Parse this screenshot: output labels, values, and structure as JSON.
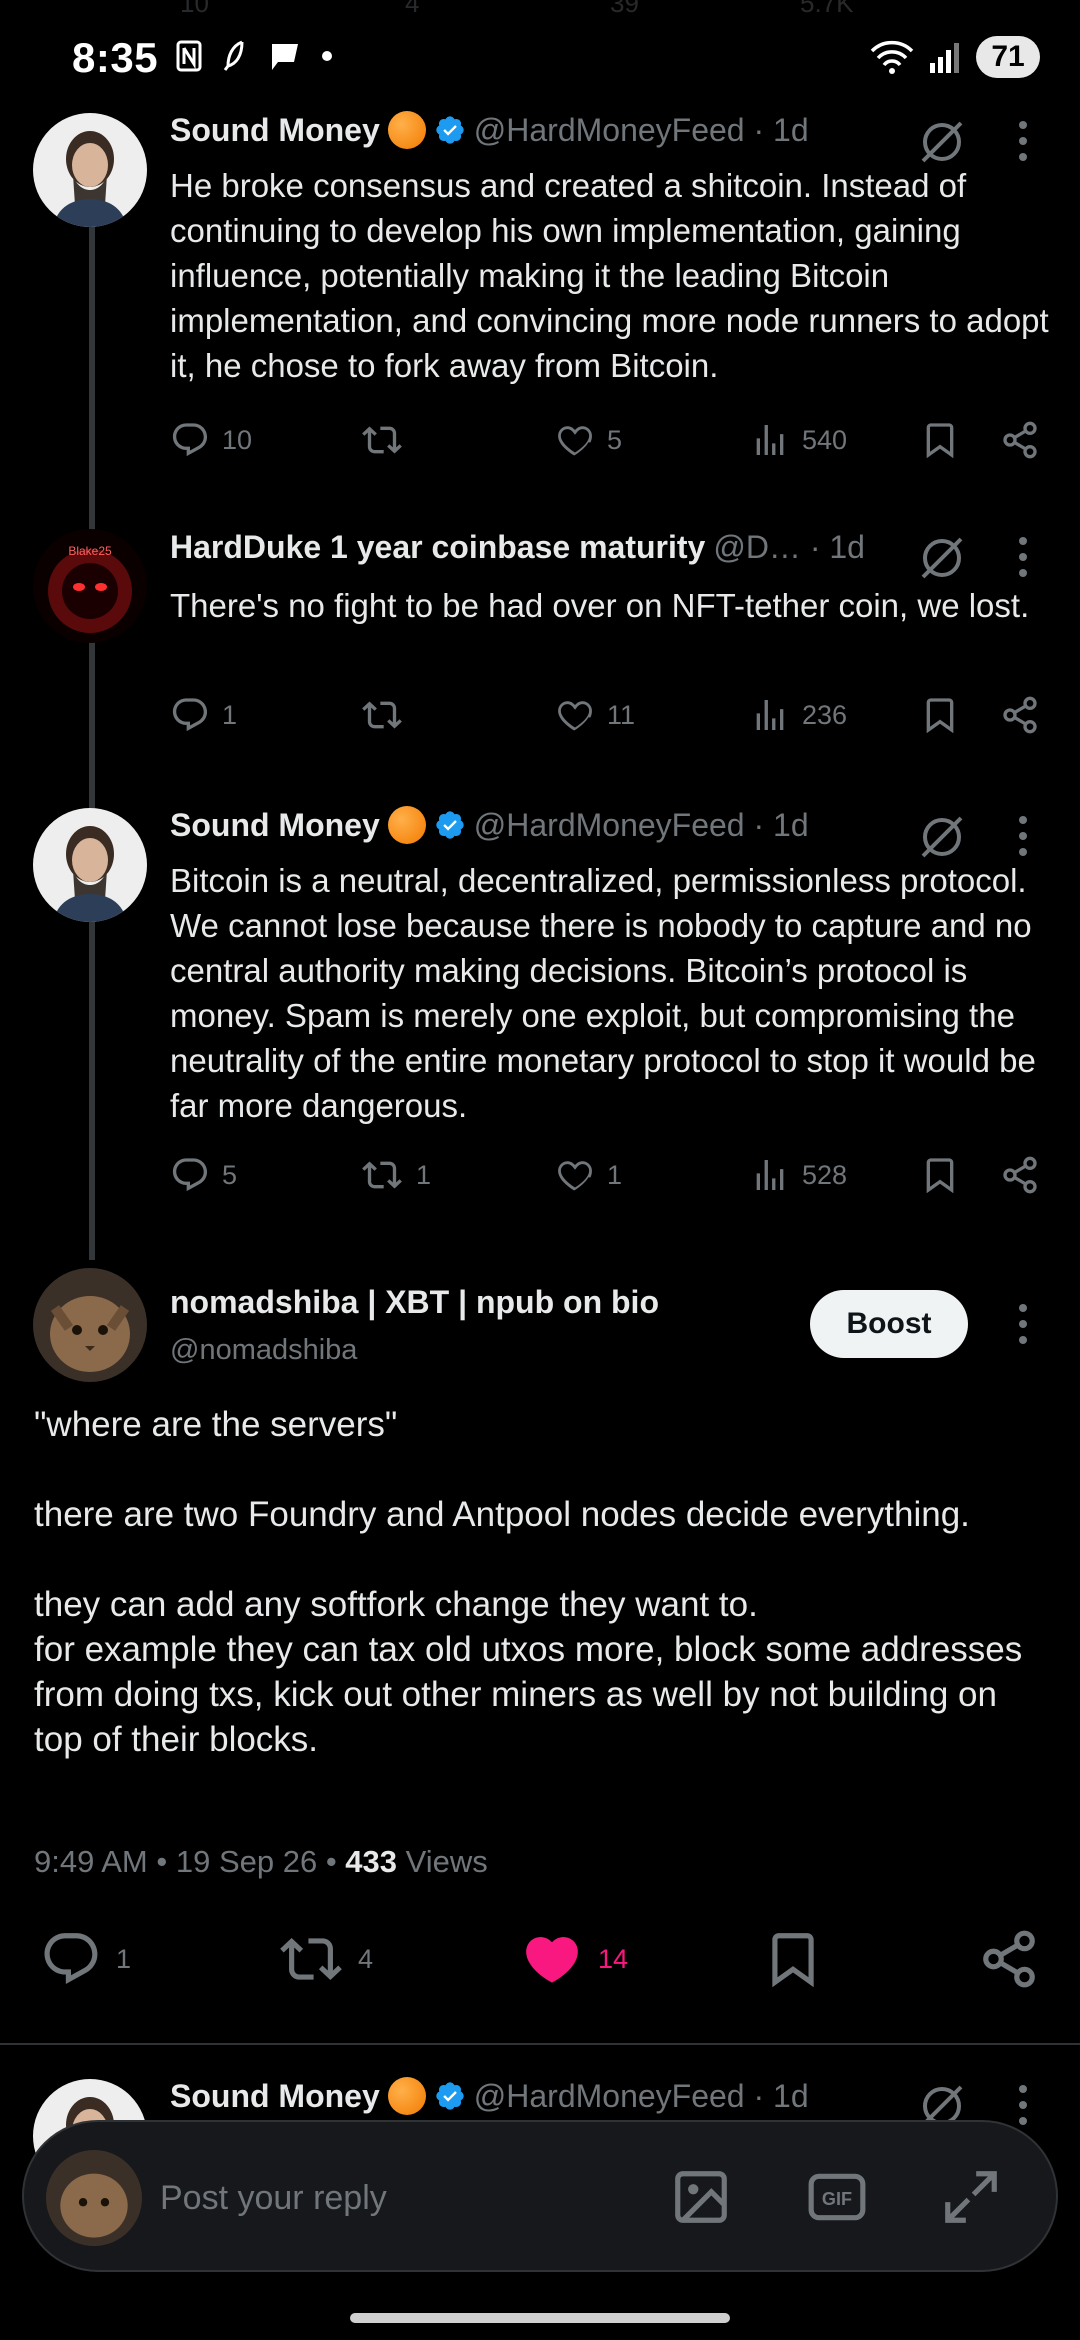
{
  "status": {
    "time": "8:35",
    "battery": "71"
  },
  "ghost_row": {
    "reply": "10",
    "repost": "4",
    "like": "39",
    "views": "5.7K"
  },
  "tweets": [
    {
      "name": "Sound Money",
      "handle": "@HardMoneyFeed · 1d",
      "text": "He broke consensus and created a shitcoin. Instead of continuing to develop his own implementation, gaining influence, potentially making it the leading Bitcoin implementation, and convincing more node runners to adopt it, he chose to fork away from Bitcoin.",
      "replies": "10",
      "reposts": "",
      "likes": "5",
      "views": "540"
    },
    {
      "name": "HardDuke 1 year coinbase maturity",
      "handle": "@D… · 1d",
      "avatar_text": "Blake25",
      "text": "There's no fight to be had over on NFT-tether coin, we lost.",
      "replies": "1",
      "reposts": "",
      "likes": "11",
      "views": "236"
    },
    {
      "name": "Sound Money",
      "handle": "@HardMoneyFeed · 1d",
      "text": "Bitcoin is a neutral, decentralized, permissionless protocol. We cannot lose because there is nobody to capture and no central authority making decisions. Bitcoin’s protocol is money. Spam is merely one exploit, but compromising the neutrality of the entire monetary protocol to stop it would be far more dangerous.",
      "replies": "5",
      "reposts": "1",
      "likes": "1",
      "views": "528"
    }
  ],
  "main_post": {
    "name": "nomadshiba | XBT | npub on bio",
    "handle": "@nomadshiba",
    "boost_label": "Boost",
    "text": "\"where are the servers\"\n\nthere are two Foundry and Antpool nodes decide everything.\n\nthey can add any softfork change they want to.\nfor example they can tax old utxos more, block some addresses from doing txs, kick out other miners as well by not building on top of their blocks.",
    "time": "9:49 AM",
    "date": "19 Sep 26",
    "views_count": "433",
    "views_label": "Views",
    "replies": "1",
    "reposts": "4",
    "likes": "14"
  },
  "next_tweet": {
    "name": "Sound Money",
    "handle": "@HardMoneyFeed · 1d"
  },
  "reply_bar": {
    "placeholder": "Post your reply",
    "gif_label": "GIF"
  },
  "colors": {
    "accent_like": "#f91880",
    "verified": "#1d9bf0",
    "muted": "#71767b"
  }
}
